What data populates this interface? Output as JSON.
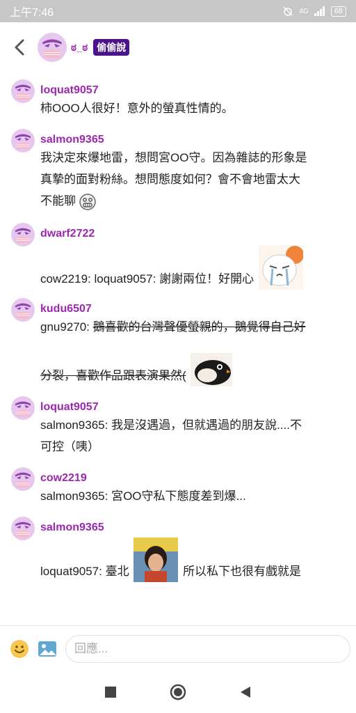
{
  "status_bar": {
    "time": "上午7:46",
    "network": "4G",
    "battery": "68"
  },
  "header": {
    "name": "ಠ_ಠ",
    "badge": "偷偷說"
  },
  "messages": [
    {
      "user": "loquat9057",
      "lines": [
        "柿OOO人很好！意外的螢真性情的。"
      ]
    },
    {
      "user": "salmon9365",
      "lines": [
        "我決定來爆地雷，想問宮OO守。因為雜誌的形象是",
        "真摯的面對粉絲。想問態度如何？會不會地雷太大",
        "不能聊"
      ],
      "emoji": "grimace-emoji"
    },
    {
      "user": "dwarf2722",
      "text": "cow2219: loquat9057: 謝謝兩位！好開心",
      "sticker": "crying-cat-sticker"
    },
    {
      "user": "kudu6507",
      "prefix": "gnu9270: ",
      "strike1": "鵝喜歡的台灣聲優螢親的，鵝覺得自己好",
      "strike2": "分裂，喜歡作品跟表演果然(",
      "sticker": "penguin-sticker"
    },
    {
      "user": "loquat9057",
      "lines": [
        "salmon9365: 我是沒遇過，但就遇過的朋友說....不",
        "可控（咦）"
      ]
    },
    {
      "user": "cow2219",
      "lines": [
        "salmon9365: 宮OO守私下態度差到爆..."
      ]
    },
    {
      "user": "salmon9365",
      "text": "loquat9057: 臺北",
      "text_after": "所以私下也很有戲就是",
      "sticker": "photo-sticker"
    }
  ],
  "composer": {
    "placeholder": "回應..."
  },
  "icons": {
    "emoji": "smiley-icon",
    "image": "image-icon",
    "back": "chevron-left-icon"
  }
}
